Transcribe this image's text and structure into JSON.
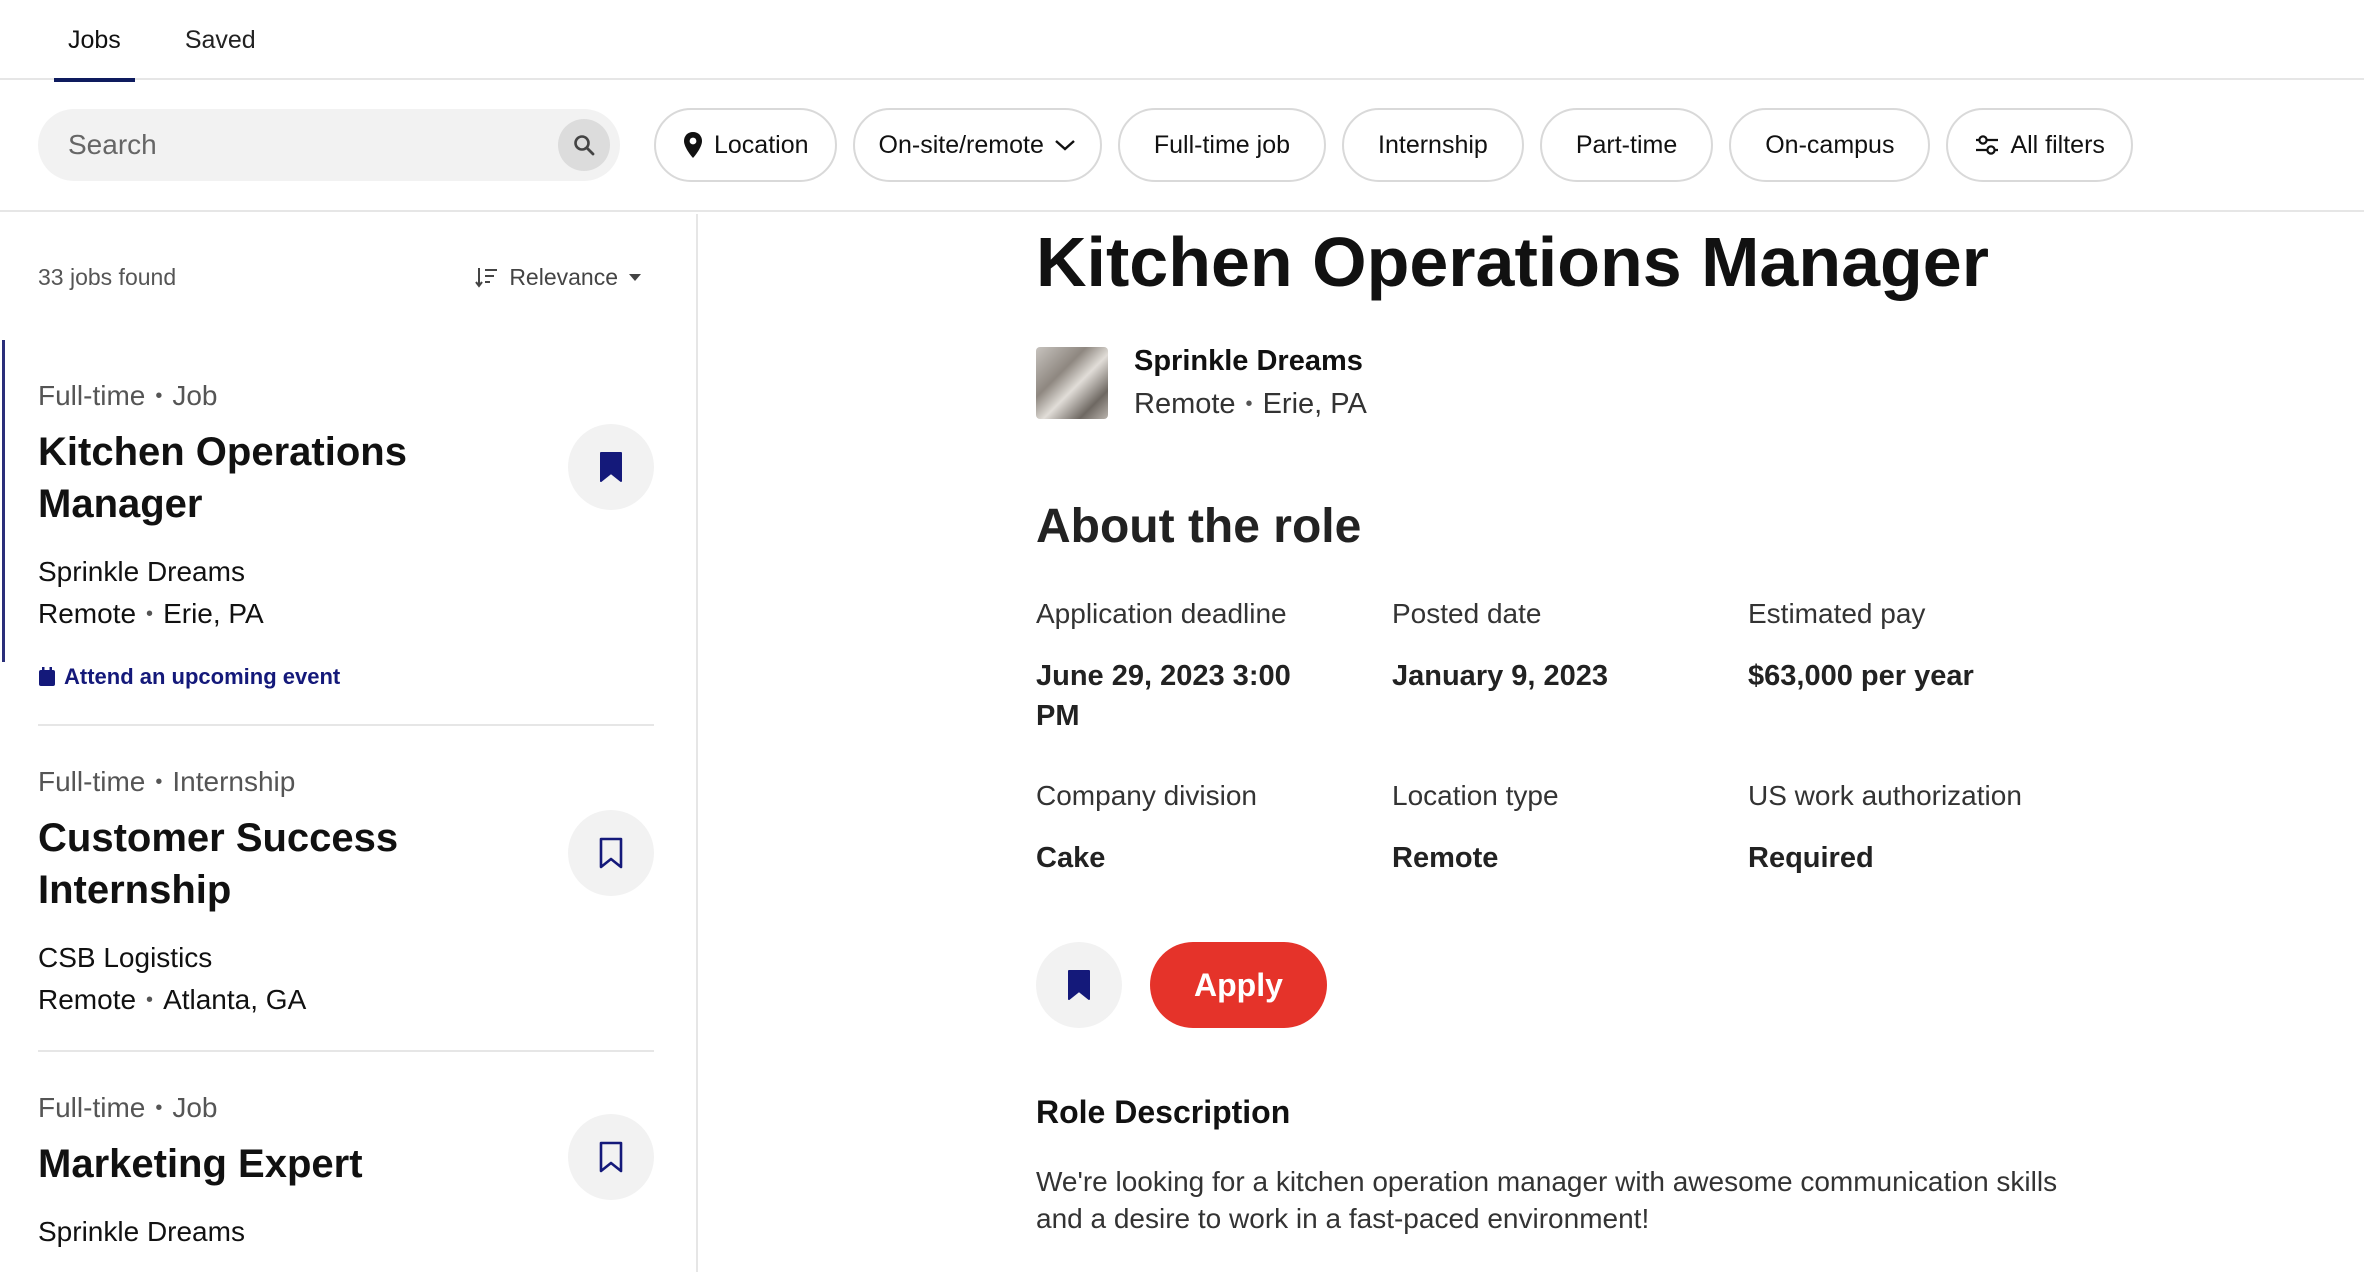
{
  "tabs": [
    {
      "label": "Jobs",
      "active": true
    },
    {
      "label": "Saved",
      "active": false
    }
  ],
  "search": {
    "placeholder": "Search",
    "value": ""
  },
  "filters": {
    "location": "Location",
    "onsite": "On-site/remote",
    "fulltime": "Full-time job",
    "internship": "Internship",
    "parttime": "Part-time",
    "oncampus": "On-campus",
    "allfilters": "All filters"
  },
  "list": {
    "count": "33 jobs found",
    "sort": "Relevance",
    "jobs": [
      {
        "type": "Full-time",
        "kind": "Job",
        "title": "Kitchen Operations Manager",
        "company": "Sprinkle Dreams",
        "mode": "Remote",
        "city": "Erie, PA",
        "event": "Attend an upcoming event",
        "saved": true
      },
      {
        "type": "Full-time",
        "kind": "Internship",
        "title": "Customer Success Internship",
        "company": "CSB Logistics",
        "mode": "Remote",
        "city": "Atlanta, GA",
        "saved": false
      },
      {
        "type": "Full-time",
        "kind": "Job",
        "title": "Marketing Expert",
        "company": "Sprinkle Dreams",
        "saved": false
      }
    ]
  },
  "detail": {
    "title": "Kitchen Operations Manager",
    "employer": "Sprinkle Dreams",
    "mode": "Remote",
    "city": "Erie, PA",
    "about": "About the role",
    "facts": [
      {
        "label": "Application deadline",
        "value": "June 29, 2023 3:00 PM"
      },
      {
        "label": "Posted date",
        "value": "January 9, 2023"
      },
      {
        "label": "Estimated pay",
        "value": "$63,000 per year"
      },
      {
        "label": "Company division",
        "value": "Cake"
      },
      {
        "label": "Location type",
        "value": "Remote"
      },
      {
        "label": "US work authorization",
        "value": "Required"
      }
    ],
    "apply": "Apply",
    "role_heading": "Role Description",
    "role_text": "We're looking for a kitchen operation manager with awesome communication skills and a desire to work in a fast-paced environment!"
  },
  "colors": {
    "accent": "#0e1b5e",
    "apply": "#e5332a",
    "event": "#14197a"
  }
}
